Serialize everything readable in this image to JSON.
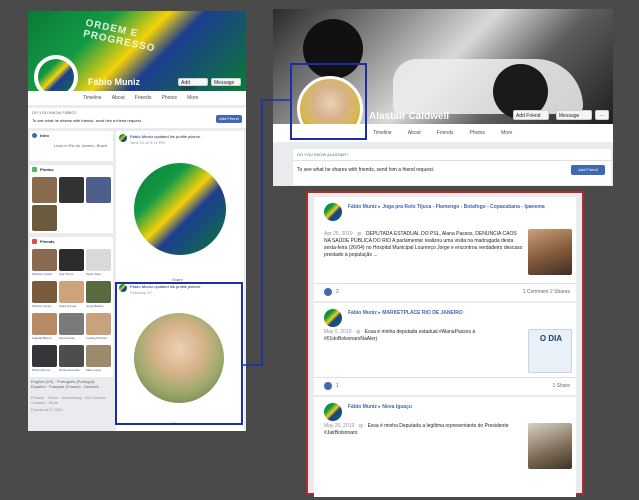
{
  "left": {
    "cover_banner": "ORDEM E PROGRESSO",
    "profile_name": "Fábio Muniz",
    "add_friend": "Add Friend",
    "message": "Message",
    "tabs": [
      "Timeline",
      "About",
      "Friends",
      "Photos",
      "More"
    ],
    "know_text": "DO YOU KNOW FÁBIO?",
    "shares_text": "To see what he shares with friends, send him a friend request.",
    "intro_label": "Intro",
    "intro_text": "Lives in Rio de Janeiro, Brazil",
    "photos_label": "Photos",
    "friends_label": "Friends",
    "friend_names": [
      "Marcelo Castro",
      "Ana Torres",
      "Pedro Dias",
      "Marcelo Vieira",
      "Clara Gomes",
      "Jorge Bastos",
      "Claudia Barros",
      "Sonia Faria",
      "Ludwig Pinheiro",
      "Paulo Ramos",
      "Daniel Azevedo",
      "Max Lessa"
    ],
    "lang_text": "English (US) · Português (Portugal) · Español · Français (France) · Deutsch",
    "footer_text": "Privacy · Terms · Advertising · Ad Choices · Cookies · More",
    "copyright": "Facebook © 2020",
    "post1_author": "Fábio Muniz",
    "post1_action": "updated his profile picture.",
    "post1_date": "June 12 at 3:14 PM",
    "post2_author": "Fábio Muniz",
    "post2_action": "updated his profile picture.",
    "post2_date": "February 20",
    "share": "Share"
  },
  "right_top": {
    "profile_name": "Alastair Caldwell",
    "add_friend": "Add Friend",
    "message": "Message",
    "more_dots": "···",
    "tabs": [
      "Timeline",
      "About",
      "Friends",
      "Photos",
      "More"
    ],
    "know_text": "DO YOU KNOW ALASTAIR?",
    "shares_text": "To see what he shares with friends, send him a friend request.",
    "add_friend_btn": "Add Friend"
  },
  "posts": [
    {
      "author": "Fábio Muniz",
      "arrow": "▸",
      "group": "Joga pra Rolo Tijuca - Flamengo - Botafogo - Copacabana - Ipanema",
      "date": "Apr 26, 2019 · ",
      "text": "DEPUTADA ESTADUAL DO PSL, Alana Passos, DENUNCIA CAOS NA SAÚDE PÚBLICA DO RIO A parlamentar realizou uma visita na madrugada desta sexta-feira (26/04) no Hospital Municipal Lourenço Jorge e encontrou verdadeiro descaso prestado à população ...",
      "reactions": "2",
      "stats": "1 Comment  2 Shares"
    },
    {
      "author": "Fábio Muniz",
      "arrow": "▸",
      "group": "MARKETPLACE RIO DE JANEIRO",
      "date": "May 5, 2019 · ",
      "text": "Essa é minha deputada estadual #AlanaPassos á #01doBolsonaroNaAlerj",
      "thumb_label": "O DIA",
      "reactions": "1",
      "stats": "1 Share"
    },
    {
      "author": "Fábio Muniz",
      "arrow": "▸",
      "group": "Nova Iguaçu",
      "date": "May 20, 2019 · ",
      "text": "Essa é minha Deputada a legítima representante do Presidente #JairBolsonaro",
      "reactions": "",
      "stats": ""
    }
  ],
  "colors": {
    "fb_blue": "#4267b2",
    "highlight_blue": "#1b2fa8",
    "highlight_red": "#b22b2b",
    "background": "#4a4a4a"
  }
}
